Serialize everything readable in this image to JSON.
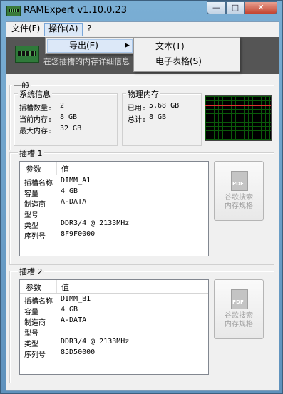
{
  "window": {
    "title": "RAMExpert v1.10.0.23"
  },
  "controls": {
    "minimize": "—",
    "maximize": "□",
    "close": "✕"
  },
  "menu": {
    "file": "文件(F)",
    "operate": "操作(A)",
    "help": "?"
  },
  "banner": {
    "text": "在您插槽的内存详细信息"
  },
  "dropdown": {
    "export_label": "导出(E)",
    "arrow": "▶"
  },
  "submenu": {
    "text": "文本(T)",
    "spreadsheet": "电子表格(S)"
  },
  "summary": {
    "group_title": "一般",
    "system_title": "系统信息",
    "slots_label": "插槽数量:",
    "slots_value": "2",
    "current_label": "当前内存:",
    "current_value": "8 GB",
    "max_label": "最大内存:",
    "max_value": "32 GB",
    "physical_title": "物理内存",
    "used_label": "已用:",
    "used_value": "5.68 GB",
    "total_label": "总计:",
    "total_value": "8 GB"
  },
  "slots": [
    {
      "title": "插槽 1",
      "header_param": "参数",
      "header_value": "值",
      "rows": [
        {
          "k": "插槽名称",
          "v": "DIMM_A1"
        },
        {
          "k": "容量",
          "v": "4 GB"
        },
        {
          "k": "制造商",
          "v": "A-DATA"
        },
        {
          "k": "型号",
          "v": ""
        },
        {
          "k": "类型",
          "v": "DDR3/4 @ 2133MHz"
        },
        {
          "k": "序列号",
          "v": "8F9F0000"
        }
      ],
      "search_line1": "谷歌搜索",
      "search_line2": "内存规格"
    },
    {
      "title": "插槽 2",
      "header_param": "参数",
      "header_value": "值",
      "rows": [
        {
          "k": "插槽名称",
          "v": "DIMM_B1"
        },
        {
          "k": "容量",
          "v": "4 GB"
        },
        {
          "k": "制造商",
          "v": "A-DATA"
        },
        {
          "k": "型号",
          "v": ""
        },
        {
          "k": "类型",
          "v": "DDR3/4 @ 2133MHz"
        },
        {
          "k": "序列号",
          "v": "85D50000"
        }
      ],
      "search_line1": "谷歌搜索",
      "search_line2": "内存规格"
    }
  ]
}
